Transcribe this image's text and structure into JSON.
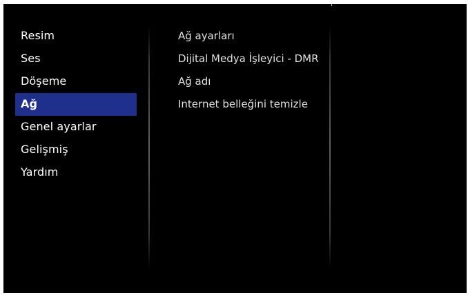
{
  "left_menu": {
    "items": [
      {
        "label": "Resim"
      },
      {
        "label": "Ses"
      },
      {
        "label": "Döşeme"
      },
      {
        "label": "Ağ"
      },
      {
        "label": "Genel ayarlar"
      },
      {
        "label": "Gelişmiş"
      },
      {
        "label": "Yardım"
      }
    ],
    "selected_index": 3
  },
  "right_menu": {
    "items": [
      {
        "label": "Ağ ayarları"
      },
      {
        "label": "Dijital Medya İşleyici - DMR"
      },
      {
        "label": "Ağ adı"
      },
      {
        "label": "Internet belleğini temizle"
      }
    ]
  },
  "colors": {
    "background": "#000000",
    "selection": "#1e2f8c",
    "text_primary": "#ffffff",
    "text_secondary": "#e0e0e0"
  }
}
